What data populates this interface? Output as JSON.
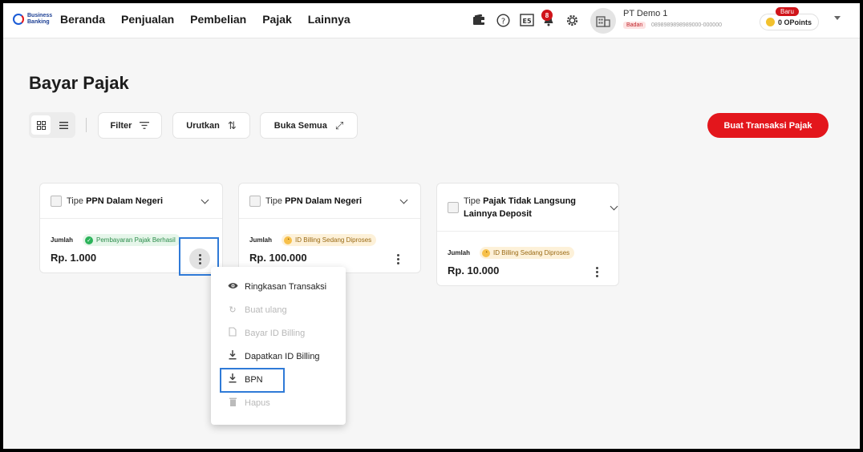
{
  "header": {
    "logo_text_line1": "Business",
    "logo_text_line2": "Banking",
    "nav": [
      "Beranda",
      "Penjualan",
      "Pembelian",
      "Pajak",
      "Lainnya"
    ],
    "notification_count": "8",
    "company_name": "PT Demo 1",
    "entity_type": "Badan",
    "npwp": "0898989898989000-000000",
    "points_badge": "Baru",
    "points": "0 OPoints"
  },
  "page": {
    "title": "Bayar Pajak",
    "filter_label": "Filter",
    "sort_label": "Urutkan",
    "expand_label": "Buka Semua",
    "create_button": "Buat Transaksi Pajak"
  },
  "cards": [
    {
      "title_prefix": "Tipe",
      "title_bold": "PPN Dalam Negeri",
      "amount_label": "Jumlah",
      "status": "Pembayaran Pajak Berhasil",
      "status_type": "success",
      "amount": "Rp. 1.000"
    },
    {
      "title_prefix": "Tipe",
      "title_bold": "PPN Dalam Negeri",
      "amount_label": "Jumlah",
      "status": "ID Billing Sedang Diproses",
      "status_type": "pending",
      "amount": "Rp. 100.000"
    },
    {
      "title_prefix": "Tipe",
      "title_bold": "Pajak Tidak Langsung Lainnya Deposit",
      "amount_label": "Jumlah",
      "status": "ID Billing Sedang Diproses",
      "status_type": "pending",
      "amount": "Rp. 10.000"
    }
  ],
  "menu": [
    {
      "label": "Ringkasan Transaksi",
      "icon": "eye-icon",
      "disabled": false
    },
    {
      "label": "Buat ulang",
      "icon": "refresh-icon",
      "disabled": true
    },
    {
      "label": "Bayar ID Billing",
      "icon": "document-icon",
      "disabled": true
    },
    {
      "label": "Dapatkan ID Billing",
      "icon": "download-icon",
      "disabled": false
    },
    {
      "label": "BPN",
      "icon": "download-icon",
      "disabled": false
    },
    {
      "label": "Hapus",
      "icon": "trash-icon",
      "disabled": true
    }
  ],
  "colors": {
    "brand_red": "#e3161c",
    "highlight_blue": "#2f7ad7",
    "success_green": "#2bb35a",
    "pending_yellow": "#f7c04a"
  }
}
